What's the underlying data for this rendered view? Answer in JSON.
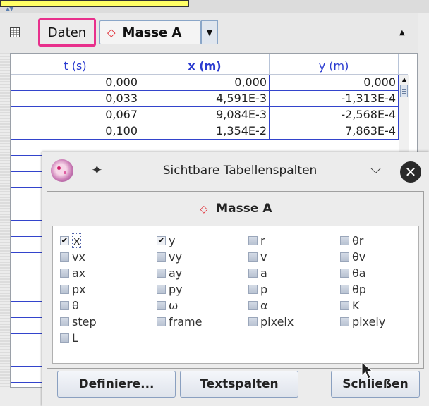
{
  "toolbar": {
    "daten_label": "Daten",
    "mass_label": "Masse A",
    "mass_symbol": "◇"
  },
  "table": {
    "columns": [
      "t (s)",
      "x (m)",
      "y (m)"
    ],
    "rows": [
      [
        "0,000",
        "0,000",
        "0,000"
      ],
      [
        "0,033",
        "4,591E-3",
        "-1,313E-4"
      ],
      [
        "0,067",
        "9,084E-3",
        "-2,568E-4"
      ],
      [
        "0,100",
        "1,354E-2",
        "7,863E-4"
      ]
    ]
  },
  "dialog": {
    "title": "Sichtbare Tabellenspalten",
    "heading": "Masse A",
    "heading_symbol": "◇",
    "checkboxes": [
      {
        "label": "x",
        "checked": true
      },
      {
        "label": "y",
        "checked": true
      },
      {
        "label": "r",
        "checked": false
      },
      {
        "label": "θr",
        "checked": false
      },
      {
        "label": "vx",
        "checked": false
      },
      {
        "label": "vy",
        "checked": false
      },
      {
        "label": "v",
        "checked": false
      },
      {
        "label": "θv",
        "checked": false
      },
      {
        "label": "ax",
        "checked": false
      },
      {
        "label": "ay",
        "checked": false
      },
      {
        "label": "a",
        "checked": false
      },
      {
        "label": "θa",
        "checked": false
      },
      {
        "label": "px",
        "checked": false
      },
      {
        "label": "py",
        "checked": false
      },
      {
        "label": "p",
        "checked": false
      },
      {
        "label": "θp",
        "checked": false
      },
      {
        "label": "θ",
        "checked": false
      },
      {
        "label": "ω",
        "checked": false
      },
      {
        "label": "α",
        "checked": false
      },
      {
        "label": "K",
        "checked": false
      },
      {
        "label": "step",
        "checked": false
      },
      {
        "label": "frame",
        "checked": false
      },
      {
        "label": "pixelx",
        "checked": false
      },
      {
        "label": "pixely",
        "checked": false
      },
      {
        "label": "L",
        "checked": false
      }
    ],
    "buttons": {
      "define": "Definiere...",
      "textcols": "Textspalten",
      "close": "Schließen"
    }
  },
  "colors": {
    "highlight_border": "#e8308c",
    "header_text": "#2a3bd0",
    "mass_symbol": "#e0202a"
  }
}
